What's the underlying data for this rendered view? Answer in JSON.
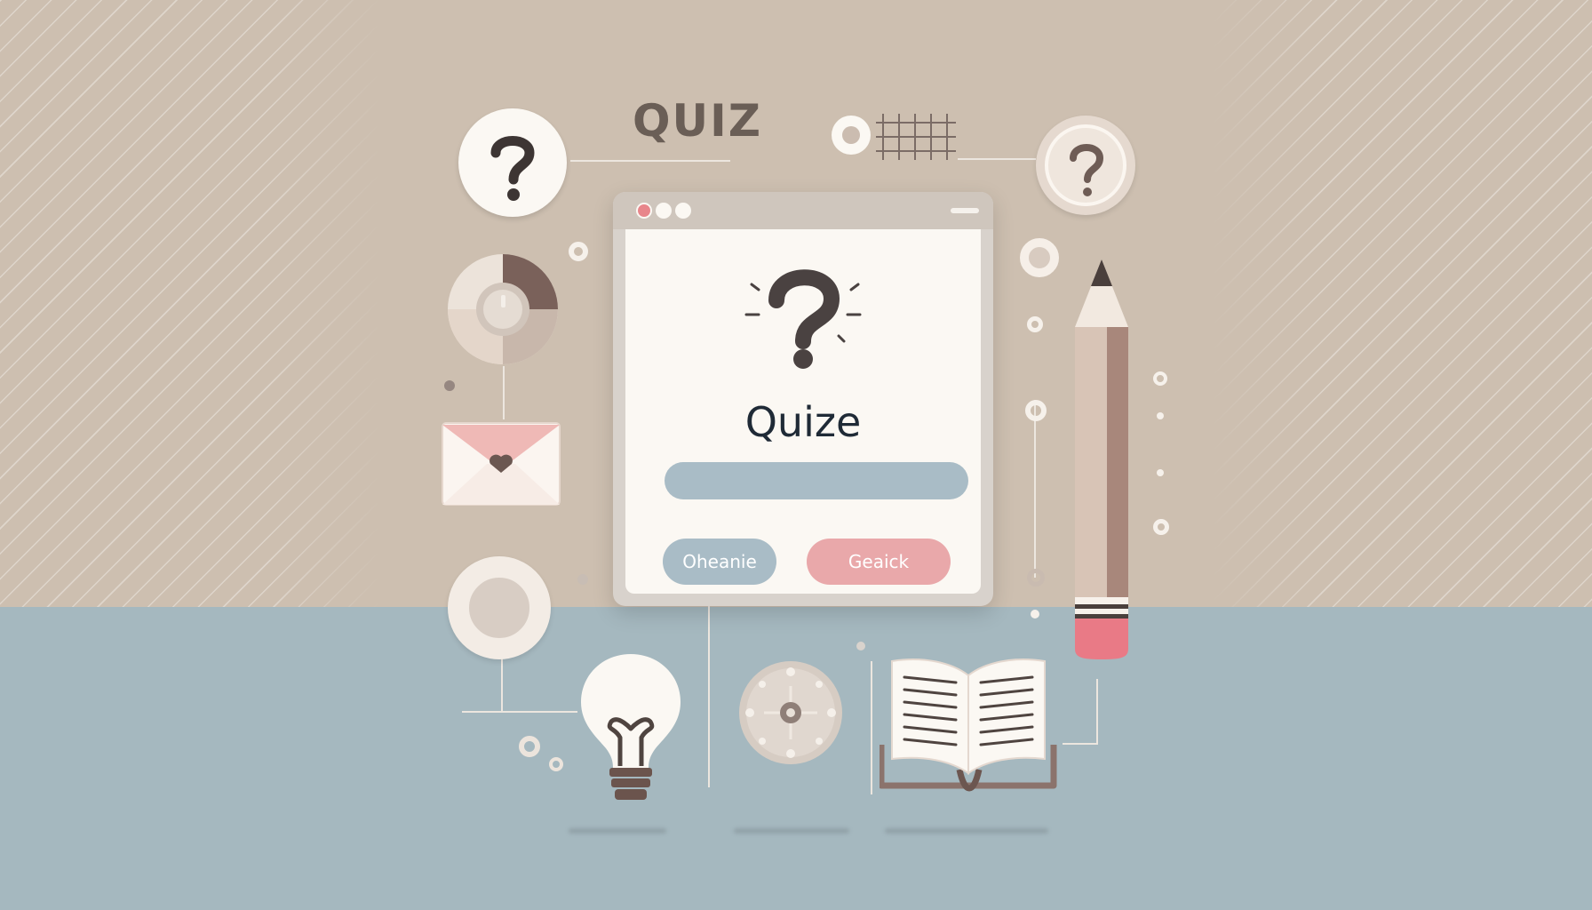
{
  "heading": "QUIZ",
  "window": {
    "title": "Quize",
    "input_placeholder": "",
    "buttons": {
      "primary_label": "Oheanie",
      "secondary_label": "Geaick"
    }
  },
  "colors": {
    "top_background": "#cdbfb0",
    "bottom_background": "#a5b8bf",
    "accent_blue": "#a9bcc6",
    "accent_pink": "#e9a8aa",
    "dark_brown": "#5b4d46"
  },
  "icons": [
    "question-mark-icon",
    "pie-chart-icon",
    "envelope-icon",
    "ring-icon",
    "lightbulb-icon",
    "compass-icon",
    "open-book-icon",
    "pencil-icon",
    "grid-icon",
    "question-coin-icon"
  ]
}
